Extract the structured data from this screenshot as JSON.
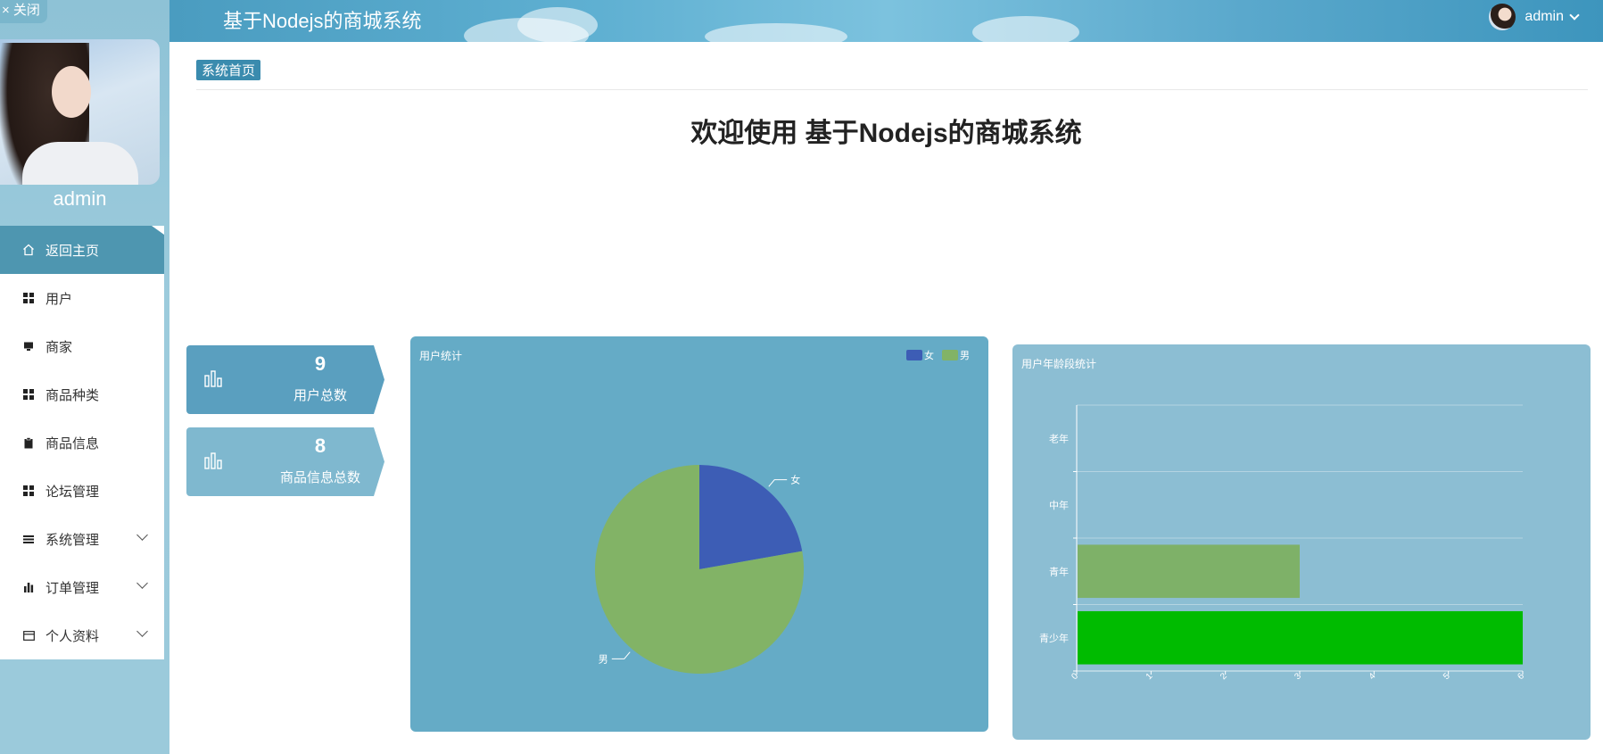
{
  "sidebar": {
    "close_label": "× 关闭",
    "username": "admin",
    "items": [
      {
        "label": "返回主页",
        "icon": "home-icon",
        "active": true
      },
      {
        "label": "用户",
        "icon": "grid-icon"
      },
      {
        "label": "商家",
        "icon": "monitor-icon"
      },
      {
        "label": "商品种类",
        "icon": "grid-icon"
      },
      {
        "label": "商品信息",
        "icon": "clipboard-icon"
      },
      {
        "label": "论坛管理",
        "icon": "grid-icon"
      },
      {
        "label": "系统管理",
        "icon": "list-icon",
        "expandable": true
      },
      {
        "label": "订单管理",
        "icon": "bar-chart-icon",
        "expandable": true
      },
      {
        "label": "个人资料",
        "icon": "card-icon",
        "expandable": true
      }
    ]
  },
  "header": {
    "title": "基于Nodejs的商城系统",
    "username": "admin"
  },
  "main": {
    "breadcrumb": "系统首页",
    "welcome": "欢迎使用 基于Nodejs的商城系统"
  },
  "stats": [
    {
      "value": "9",
      "label": "用户总数",
      "icon": "bar-chart-icon"
    },
    {
      "value": "8",
      "label": "商品信息总数",
      "icon": "bar-chart-icon"
    }
  ],
  "colors": {
    "accent": "#4e96b0",
    "pie_female": "#3d5db5",
    "pie_male": "#82b366",
    "bar_youth": "#7eb168",
    "bar_teen": "#00bb00"
  },
  "chart_data": [
    {
      "type": "pie",
      "title": "用户统计",
      "legend": [
        "女",
        "男"
      ],
      "legend_position": "top-right",
      "slices": [
        {
          "name": "女",
          "value": 2
        },
        {
          "name": "男",
          "value": 7
        }
      ]
    },
    {
      "type": "bar",
      "orientation": "horizontal",
      "title": "用户年龄段统计",
      "categories": [
        "青少年",
        "青年",
        "中年",
        "老年"
      ],
      "values": [
        6,
        3,
        0,
        0
      ],
      "xlim": [
        0,
        6
      ],
      "xticks": [
        "0",
        "1",
        "2",
        "3",
        "4",
        "5",
        "6"
      ],
      "grid": true
    }
  ]
}
